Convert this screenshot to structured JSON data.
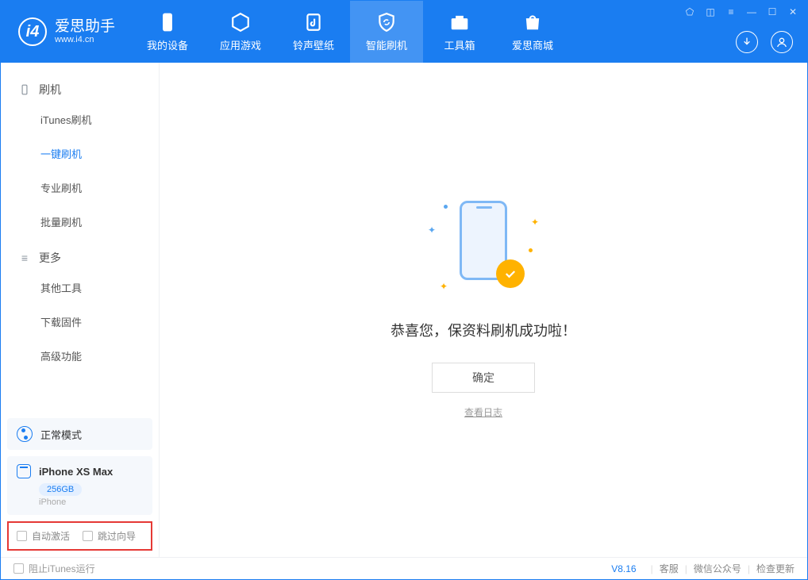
{
  "app": {
    "title": "爱思助手",
    "subtitle": "www.i4.cn"
  },
  "nav": {
    "my_device": "我的设备",
    "apps_games": "应用游戏",
    "rings_walls": "铃声壁纸",
    "smart_flash": "智能刷机",
    "toolbox": "工具箱",
    "store": "爱思商城"
  },
  "sidebar": {
    "flash_header": "刷机",
    "items": {
      "itunes": "iTunes刷机",
      "onekey": "一键刷机",
      "pro": "专业刷机",
      "batch": "批量刷机"
    },
    "more_header": "更多",
    "more": {
      "other_tools": "其他工具",
      "firmware": "下载固件",
      "advanced": "高级功能"
    },
    "mode": "正常模式",
    "device": {
      "name": "iPhone XS Max",
      "storage": "256GB",
      "type": "iPhone"
    },
    "opts": {
      "auto_activate": "自动激活",
      "skip_guide": "跳过向导"
    }
  },
  "main": {
    "message": "恭喜您，保资料刷机成功啦！",
    "ok": "确定",
    "log": "查看日志"
  },
  "footer": {
    "block_itunes": "阻止iTunes运行",
    "version": "V8.16",
    "support": "客服",
    "wechat": "微信公众号",
    "update": "检查更新"
  }
}
